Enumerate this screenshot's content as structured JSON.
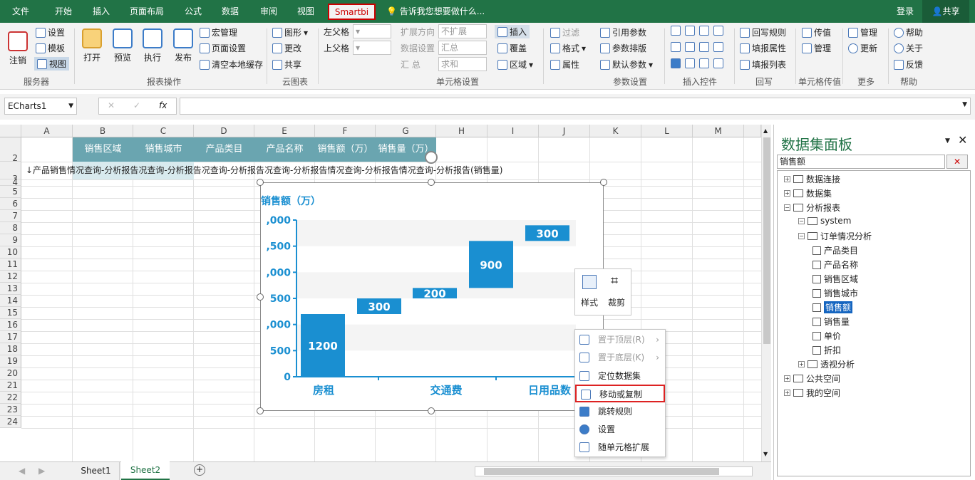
{
  "tabs": [
    "文件",
    "开始",
    "插入",
    "页面布局",
    "公式",
    "数据",
    "审阅",
    "视图",
    "Smartbi"
  ],
  "tell_me": "告诉我您想要做什么...",
  "login": "登录",
  "share": "共享",
  "server": {
    "logout": "注销",
    "settings": "设置",
    "template": "模板",
    "view": "视图",
    "group": "服务器"
  },
  "report_ops": {
    "open": "打开",
    "preview": "预览",
    "execute": "执行",
    "publish": "发布",
    "macro": "宏管理",
    "page_setup": "页面设置",
    "clear_cache": "清空本地缓存",
    "group": "报表操作"
  },
  "cloud": {
    "chart": "图形",
    "modify": "更改",
    "share": "共享",
    "group": "云图表"
  },
  "cell": {
    "left_parent": "左父格",
    "top_parent": "上父格",
    "expand_dir": "扩展方向",
    "expand_val": "不扩展",
    "data_setting": "数据设置",
    "data_val": "汇总",
    "agg": "汇   总",
    "agg_val": "求和",
    "insert": "插入",
    "cover": "覆盖",
    "area": "区域",
    "group": "单元格设置"
  },
  "params": {
    "filter": "过滤",
    "format": "格式",
    "attr": "属性",
    "ref_param": "引用参数",
    "param_layout": "参数排版",
    "default_param": "默认参数",
    "group": "参数设置"
  },
  "insert_ctrl": {
    "group": "插入控件"
  },
  "writeback": {
    "rule": "回写规则",
    "attr": "填报属性",
    "list": "填报列表",
    "group": "回写"
  },
  "cell_pass": {
    "pass": "传值",
    "manage": "管理",
    "group": "单元格传值"
  },
  "more": {
    "manage": "管理",
    "update": "更新",
    "group": "更多"
  },
  "help": {
    "help": "帮助",
    "about": "关于",
    "feedback": "反馈",
    "group": "帮助"
  },
  "namebox": "ECharts1",
  "columns": [
    "A",
    "B",
    "C",
    "D",
    "E",
    "F",
    "G",
    "H",
    "I",
    "J",
    "K",
    "L",
    "M"
  ],
  "rows": [
    "2",
    "3",
    "4",
    "5",
    "6",
    "7",
    "8",
    "9",
    "10",
    "11",
    "12",
    "13",
    "14",
    "15",
    "16",
    "17",
    "18",
    "19",
    "20",
    "21",
    "22",
    "23",
    "24"
  ],
  "header_cells": [
    "销售区域",
    "销售城市",
    "产品类目",
    "产品名称",
    "销售额（万）",
    "销售量（万）"
  ],
  "row3_text": "↓产品销售情况查询-分析报告况查询-分析报告况查询-分析报告况查询-分析报告情况查询-分析报告情况查询-分析报告(销售量)",
  "chart_data": {
    "type": "bar",
    "title": "销售额（万）",
    "categories": [
      "房租",
      "交通费",
      "日用品数"
    ],
    "ylim": [
      0,
      3000
    ],
    "yticks": [
      ",000",
      ",500",
      ",000",
      "500",
      ",000",
      "500",
      "0"
    ],
    "bars": [
      {
        "label": "1200",
        "base": 0,
        "value": 1200
      },
      {
        "label": "300",
        "base": 1200,
        "value": 300
      },
      {
        "label": "200",
        "base": 1500,
        "value": 200
      },
      {
        "label": "900",
        "base": 1700,
        "value": 900
      },
      {
        "label": "300",
        "base": 2600,
        "value": 300
      }
    ],
    "color": "#1a8fd1"
  },
  "style_box": {
    "style": "样式",
    "crop": "裁剪"
  },
  "context_menu": [
    "置于顶层(R)",
    "置于底层(K)",
    "定位数据集",
    "移动或复制",
    "跳转规则",
    "设置",
    "随单元格扩展"
  ],
  "sheets": [
    "Sheet1",
    "Sheet2"
  ],
  "panel": {
    "title": "数据集面板",
    "search": "销售额",
    "tree": [
      "数据连接",
      "数据集",
      "分析报表",
      "system",
      "订单情况分析",
      "产品类目",
      "产品名称",
      "销售区域",
      "销售城市",
      "销售额",
      "销售量",
      "单价",
      "折扣",
      "透视分析",
      "公共空间",
      "我的空间"
    ]
  }
}
